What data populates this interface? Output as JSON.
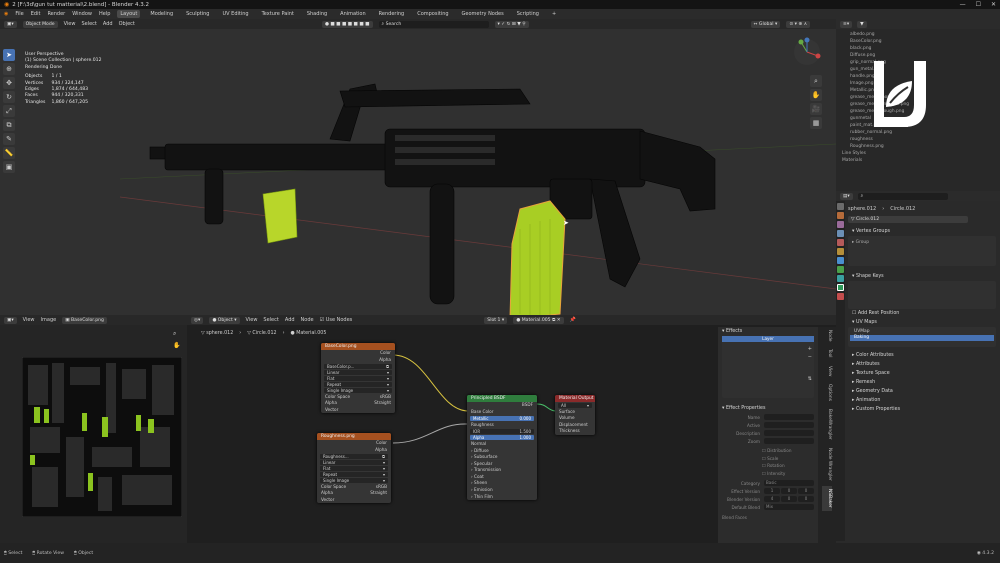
{
  "titlebar": {
    "title": "2 [F:\\3d\\gun tut matterial\\2.blend] - Blender 4.3.2"
  },
  "menu": [
    "File",
    "Edit",
    "Render",
    "Window",
    "Help"
  ],
  "workspaces": [
    "Layout",
    "Modeling",
    "Sculpting",
    "UV Editing",
    "Texture Paint",
    "Shading",
    "Animation",
    "Rendering",
    "Compositing",
    "Geometry Nodes",
    "Scripting",
    "+"
  ],
  "viewport": {
    "mode": "Object Mode",
    "menus": [
      "View",
      "Select",
      "Add",
      "Object"
    ],
    "orientation": "Global",
    "search_placeholder": "Search",
    "overlay": {
      "line1": "User Perspective",
      "line2": "(1) Scene Collection | sphere.012",
      "line3": "Rendering Done",
      "stats": [
        {
          "label": "Objects",
          "value": "1 / 1"
        },
        {
          "label": "Vertices",
          "value": "934 / 324,147"
        },
        {
          "label": "Edges",
          "value": "1,874 / 644,483"
        },
        {
          "label": "Faces",
          "value": "944 / 320,331"
        },
        {
          "label": "Triangles",
          "value": "1,860 / 647,205"
        }
      ]
    }
  },
  "outliner": {
    "items": [
      "albedo.png",
      "BaseColor.png",
      "black.png",
      "Diffuse.png",
      "grip_normal.png",
      "gun_metal.png",
      "handle.png",
      "Image.png",
      "Metallic.png",
      "grease_metal_normal.png",
      "grease_metal_metallic.png",
      "grease_metal_rough.png",
      "gunmetal",
      "paint_mat.png",
      "rubber_normal.png",
      "roughness",
      "Roughness.png"
    ],
    "groups": [
      "Line Styles",
      "Materials"
    ]
  },
  "properties": {
    "object_name": "sphere.012",
    "data_name": "Circle.012",
    "data_name2": "Circle.012",
    "sections": {
      "vertex_groups": "Vertex Groups",
      "vg_item": "Group",
      "shape_keys": "Shape Keys",
      "add_rest": "Add Rest Position",
      "uv_maps": "UV Maps",
      "color_attrs": "Color Attributes",
      "attributes": "Attributes",
      "texture_space": "Texture Space",
      "remesh": "Remesh",
      "geometry_data": "Geometry Data",
      "animation": "Animation",
      "custom_props": "Custom Properties"
    },
    "uv_maps": [
      "UVMap",
      "Baking"
    ]
  },
  "image_editor": {
    "menus": [
      "View",
      "Image"
    ],
    "image_name": "BaseColor.png"
  },
  "node_editor": {
    "type": "Object",
    "menus": [
      "View",
      "Select",
      "Add",
      "Node"
    ],
    "use_nodes": "Use Nodes",
    "slot": "Slot 1",
    "material": "Material.005",
    "breadcrumb": [
      "sphere.012",
      "Circle.012",
      "Material.005"
    ],
    "nodes": {
      "basecolor": {
        "title": "BaseColor.png",
        "out1": "Color",
        "out2": "Alpha",
        "file": "BaseColor.p...",
        "fields": [
          "Linear",
          "Flat",
          "Repeat",
          "Single Image"
        ],
        "cs_label": "Color Space",
        "cs_val": "sRGB",
        "alpha_label": "Alpha",
        "alpha_val": "Straight",
        "vector": "Vector"
      },
      "roughness": {
        "title": "Roughness.png",
        "out1": "Color",
        "out2": "Alpha",
        "file": "Roughness...",
        "fields": [
          "Linear",
          "Flat",
          "Repeat",
          "Single Image"
        ],
        "cs_label": "Color Space",
        "cs_val": "sRGB",
        "alpha_label": "Alpha",
        "alpha_val": "Straight",
        "vector": "Vector"
      },
      "bsdf": {
        "title": "Principled BSDF",
        "out": "BSDF",
        "base_color": "Base Color",
        "metallic": "Metallic",
        "metallic_val": "0.000",
        "roughness": "Roughness",
        "ior": "IOR",
        "ior_val": "1.500",
        "alpha": "Alpha",
        "alpha_val": "1.000",
        "normal": "Normal",
        "subsections": [
          "Diffuse",
          "Subsurface",
          "Specular",
          "Transmission",
          "Coat",
          "Sheen",
          "Emission",
          "Thin Film"
        ]
      },
      "output": {
        "title": "Material Output",
        "target": "All",
        "inputs": [
          "Surface",
          "Volume",
          "Displacement",
          "Thickness"
        ]
      }
    }
  },
  "npanel": {
    "effects": "Effects",
    "effect_item": "Layer",
    "effect_props": "Effect Properties",
    "fields": [
      "Name",
      "Active",
      "Description",
      "Zoom"
    ],
    "checks": [
      "Distribution",
      "Scale",
      "Rotation",
      "Intensity"
    ],
    "category_label": "Category",
    "category_val": "Basic",
    "rows": [
      {
        "label": "Effect Version",
        "vals": [
          "1",
          "0",
          "0"
        ]
      },
      {
        "label": "Blender Version",
        "vals": [
          "4",
          "0",
          "0"
        ]
      },
      {
        "label": "Default Blend",
        "vals": [
          "Mix"
        ]
      }
    ],
    "blend_faces": "Blend Faces",
    "tabs": [
      "Node",
      "Tool",
      "View",
      "Options",
      "BakeWrangler",
      "Node Wrangler",
      "NSBaker"
    ]
  },
  "statusbar": {
    "items": [
      "Select",
      "Rotate View",
      "Object"
    ],
    "version": "4.3.2"
  },
  "colors": {
    "accent": "#4772b3",
    "selection": "#e8a33c",
    "texture_node": "#a5501f",
    "shader_node": "#2f7d3d",
    "output_node": "#8a2a2a",
    "mag_green": "#9ad12a"
  }
}
